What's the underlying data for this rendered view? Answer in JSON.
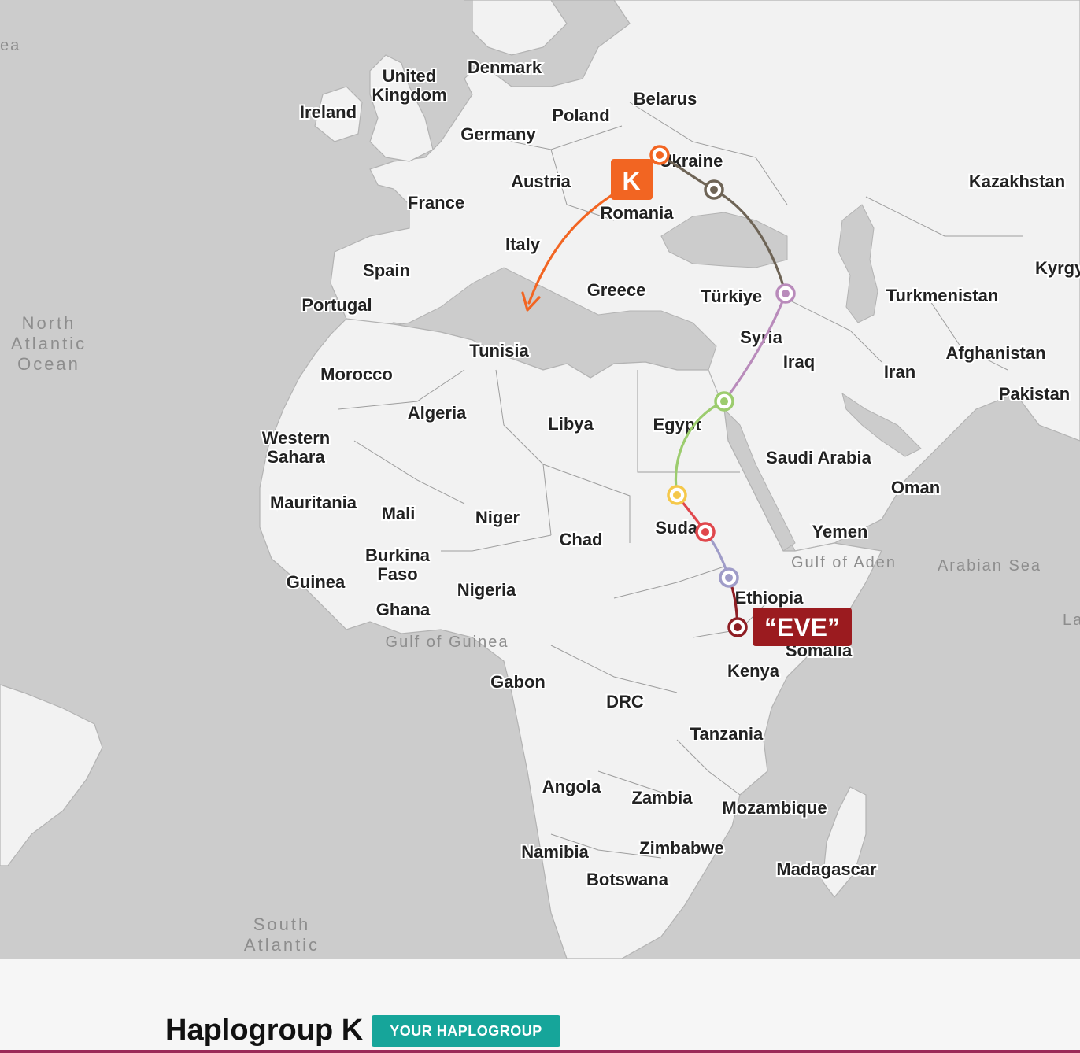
{
  "countries": {
    "denmark": "Denmark",
    "united_kingdom_1": "United",
    "united_kingdom_2": "Kingdom",
    "ireland": "Ireland",
    "belarus": "Belarus",
    "poland": "Poland",
    "germany": "Germany",
    "ukraine": "Ukraine",
    "kazakhstan": "Kazakhstan",
    "austria": "Austria",
    "france": "France",
    "romania": "Romania",
    "italy": "Italy",
    "spain": "Spain",
    "portugal": "Portugal",
    "greece": "Greece",
    "turkiye": "Türkiye",
    "turkmenistan": "Turkmenistan",
    "kyrgyz": "Kyrgy",
    "syria": "Syria",
    "iraq": "Iraq",
    "afghanistan": "Afghanistan",
    "iran": "Iran",
    "pakistan": "Pakistan",
    "tunisia": "Tunisia",
    "morocco": "Morocco",
    "algeria": "Algeria",
    "libya": "Libya",
    "egypt": "Egypt",
    "western_sahara_1": "Western",
    "western_sahara_2": "Sahara",
    "saudi_arabia": "Saudi Arabia",
    "oman": "Oman",
    "mauritania": "Mauritania",
    "mali": "Mali",
    "niger": "Niger",
    "chad": "Chad",
    "sudan": "Sudan",
    "yemen": "Yemen",
    "burkina_1": "Burkina",
    "burkina_2": "Faso",
    "guinea": "Guinea",
    "nigeria": "Nigeria",
    "ethiopia": "Ethiopia",
    "ghana": "Ghana",
    "somalia": "Somalia",
    "kenya": "Kenya",
    "gabon": "Gabon",
    "drc": "DRC",
    "tanzania": "Tanzania",
    "angola": "Angola",
    "zambia": "Zambia",
    "mozambique": "Mozambique",
    "namibia": "Namibia",
    "zimbabwe": "Zimbabwe",
    "botswana": "Botswana",
    "madagascar": "Madagascar"
  },
  "waters": {
    "north_atlantic_1": "North",
    "north_atlantic_2": "Atlantic",
    "north_atlantic_3": "Ocean",
    "south_atlantic_1": "South",
    "south_atlantic_2": "Atlantic",
    "gulf_of_guinea": "Gulf of Guinea",
    "gulf_of_aden": "Gulf of Aden",
    "arabian_sea": "Arabian Sea",
    "edge_left": "ea",
    "edge_right": "Lac"
  },
  "markers": {
    "k_label": "K",
    "eve_label": "“EVE”"
  },
  "colors": {
    "k_orange": "#f26522",
    "eve_red": "#9b1b1f",
    "teal": "#16a59a",
    "brand_line": "#9b2a58",
    "route_brown": "#6e6456",
    "route_mauve": "#b98bbb",
    "route_green": "#9ccc6e",
    "route_yellow": "#f5c84a",
    "route_red": "#e0474c",
    "route_lavender": "#9f9cc8",
    "route_darkred": "#8e1e24"
  },
  "footer": {
    "title": "Haplogroup K",
    "badge": "YOUR HAPLOGROUP"
  }
}
